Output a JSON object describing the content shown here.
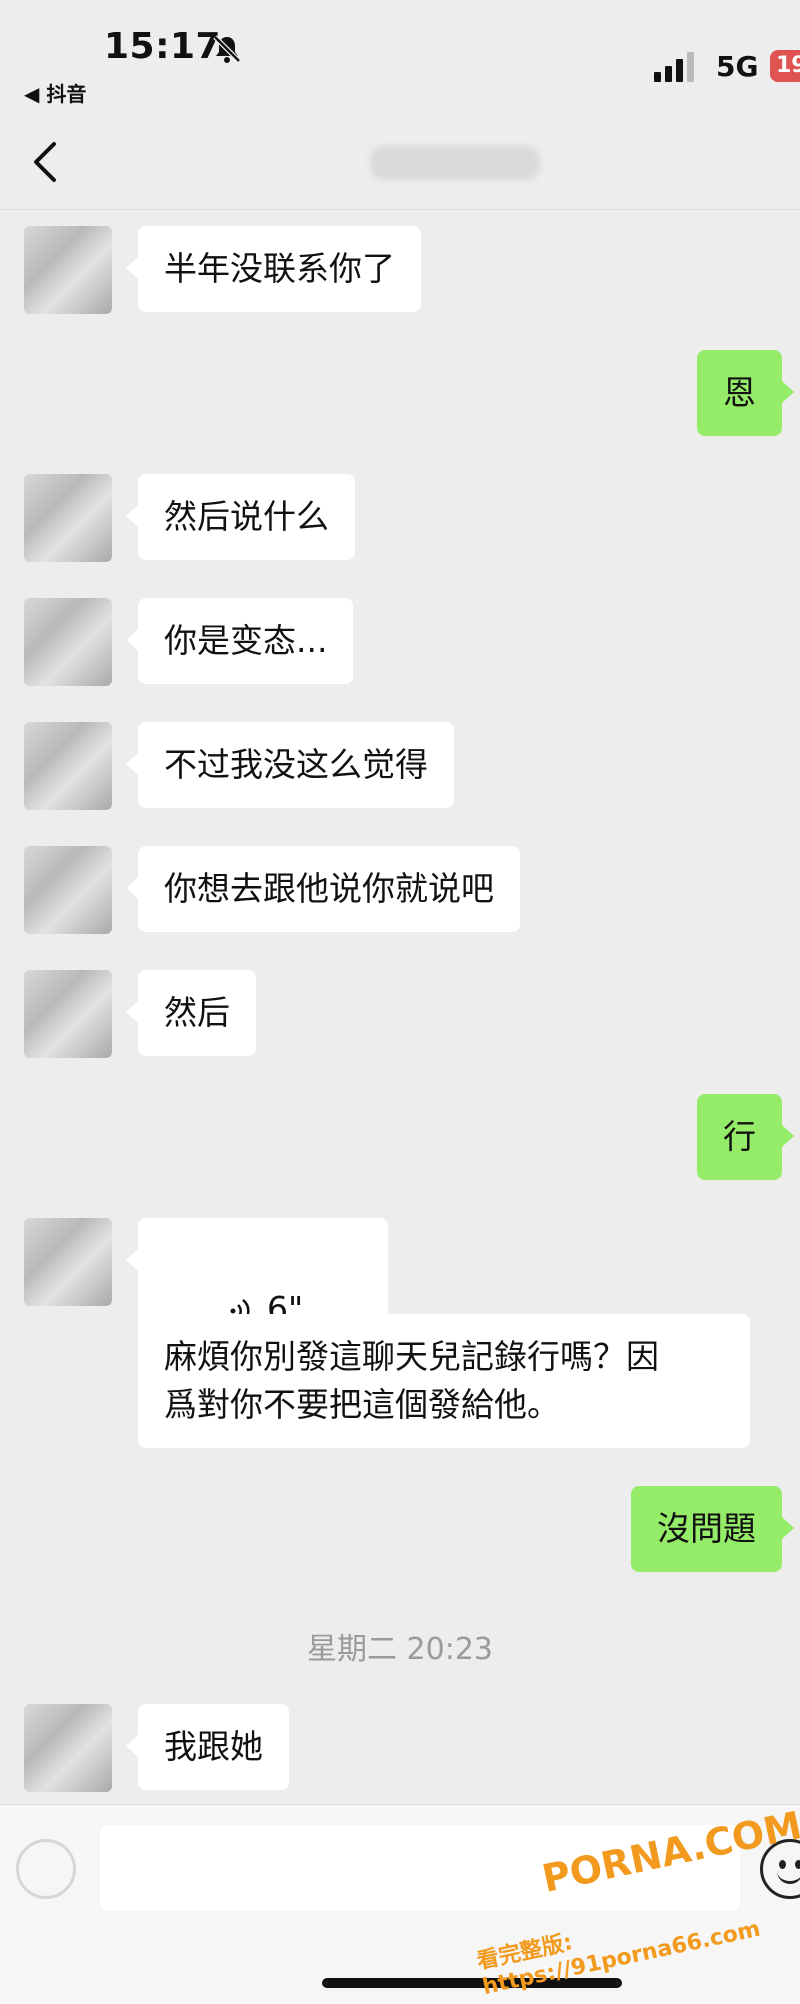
{
  "status_bar": {
    "time": "15:17",
    "back_app": "◀ 抖音",
    "network": "5G",
    "battery_badge": "19"
  },
  "messages": [
    {
      "side": "left",
      "text": "半年没联系你了"
    },
    {
      "side": "right",
      "text": "恩"
    },
    {
      "side": "left",
      "text": "然后说什么"
    },
    {
      "side": "left",
      "text": "你是变态..."
    },
    {
      "side": "left",
      "text": "不过我没这么觉得"
    },
    {
      "side": "left",
      "text": "你想去跟他说你就说吧"
    },
    {
      "side": "left",
      "text": "然后"
    },
    {
      "side": "right",
      "text": "行"
    },
    {
      "side": "left",
      "type": "voice",
      "text": "6\""
    },
    {
      "side": "left",
      "text": "麻煩你別發這聊天兒記錄行嗎？因\n爲對你不要把這個發給他。"
    },
    {
      "side": "right",
      "text": "沒問題"
    },
    {
      "type": "timestamp",
      "text": "星期二 20:23"
    },
    {
      "side": "left",
      "text": "我跟她"
    }
  ],
  "watermark": {
    "brand": "PORNA.COM",
    "url": "看完整版: https://91porna66.com"
  },
  "colors": {
    "background": "#ededed",
    "bubble_self": "#95ec69",
    "bubble_other": "#ffffff"
  }
}
